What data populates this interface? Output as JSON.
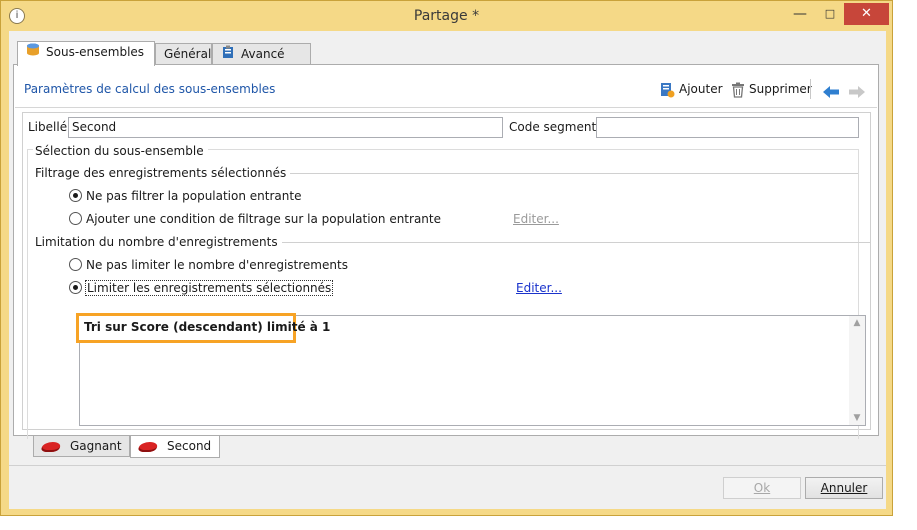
{
  "window": {
    "title": "Partage *",
    "minimize_symbol": "—",
    "maximize_symbol": "□",
    "close_symbol": "✕"
  },
  "tabs": [
    {
      "label": "Sous-ensembles",
      "icon": "database-icon"
    },
    {
      "label": "Général"
    },
    {
      "label": "Avancé",
      "icon": "clipboard-icon"
    }
  ],
  "panel": {
    "title": "Paramètres de calcul des sous-ensembles",
    "toolbar": {
      "add_label": "Ajouter",
      "delete_label": "Supprimer"
    }
  },
  "form": {
    "libelle_label": "Libellé:",
    "libelle_value": "Second",
    "code_segment_label": "Code segment:",
    "code_segment_value": ""
  },
  "selection": {
    "group_title": "Sélection du sous-ensemble",
    "filter_section": "Filtrage des enregistrements sélectionnés",
    "filter_option_none": "Ne pas filtrer la population entrante",
    "filter_option_condition": "Ajouter une condition de filtrage sur la population entrante",
    "filter_edit_link": "Editer...",
    "limit_section": "Limitation du nombre d'enregistrements",
    "limit_option_none": "Ne pas limiter le nombre d'enregistrements",
    "limit_option_limit": "Limiter les enregistrements sélectionnés",
    "limit_edit_link": "Editer...",
    "summary_text": "Tri sur Score (descendant) limité à 1"
  },
  "subset_tabs": [
    {
      "label": "Gagnant",
      "icon": "red-shape-icon"
    },
    {
      "label": "Second",
      "icon": "red-shape-icon"
    }
  ],
  "buttons": {
    "ok_label": "Ok",
    "cancel_label": "Annuler"
  },
  "colors": {
    "titlebar": "#f5d987",
    "highlight": "#f7a325",
    "link": "#1a33cc",
    "panel_title": "#1f56a8"
  }
}
